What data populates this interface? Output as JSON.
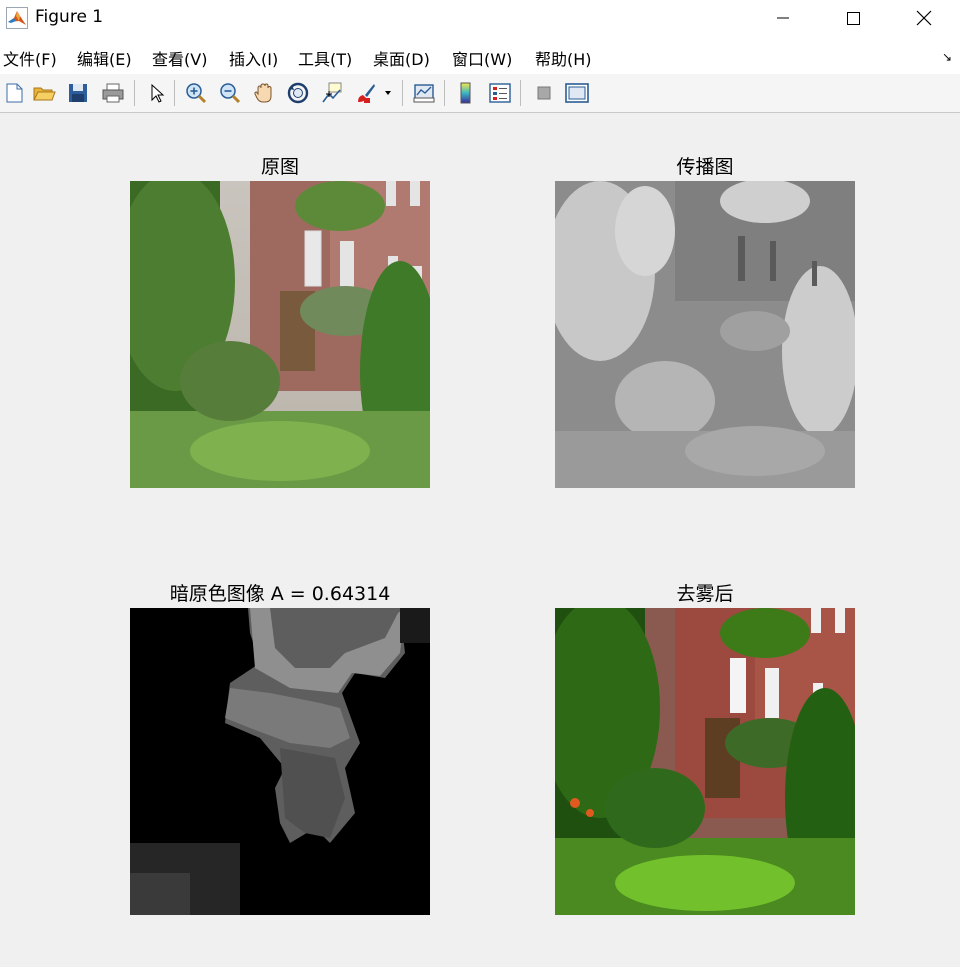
{
  "window": {
    "title": "Figure 1",
    "controls": {
      "minimize": "—",
      "maximize": "☐",
      "close": "✕"
    }
  },
  "menu": {
    "items": [
      "文件(F)",
      "编辑(E)",
      "查看(V)",
      "插入(I)",
      "工具(T)",
      "桌面(D)",
      "窗口(W)",
      "帮助(H)"
    ],
    "dock_arrow": "↘"
  },
  "toolbar": {
    "buttons": [
      "new-figure",
      "open-file",
      "save",
      "print",
      "select-arrow",
      "zoom-in",
      "zoom-out",
      "pan",
      "rotate-3d",
      "data-cursor",
      "brush",
      "brush-dropdown",
      "link-plot",
      "insert-colorbar",
      "insert-legend",
      "hide-plot-tools",
      "show-plot-tools"
    ]
  },
  "axes": [
    {
      "title": "原图",
      "image": "hazy garden photo with red brick building"
    },
    {
      "title": "传播图",
      "image": "grayscale transmission map"
    },
    {
      "title": "暗原色图像 A = 0.64314",
      "image": "dark channel image"
    },
    {
      "title": "去雾后",
      "image": "dehazed garden photo"
    }
  ],
  "colors": {
    "background": "#f0f0f0",
    "titlebar": "#ffffff",
    "menubar": "#ffffff"
  }
}
